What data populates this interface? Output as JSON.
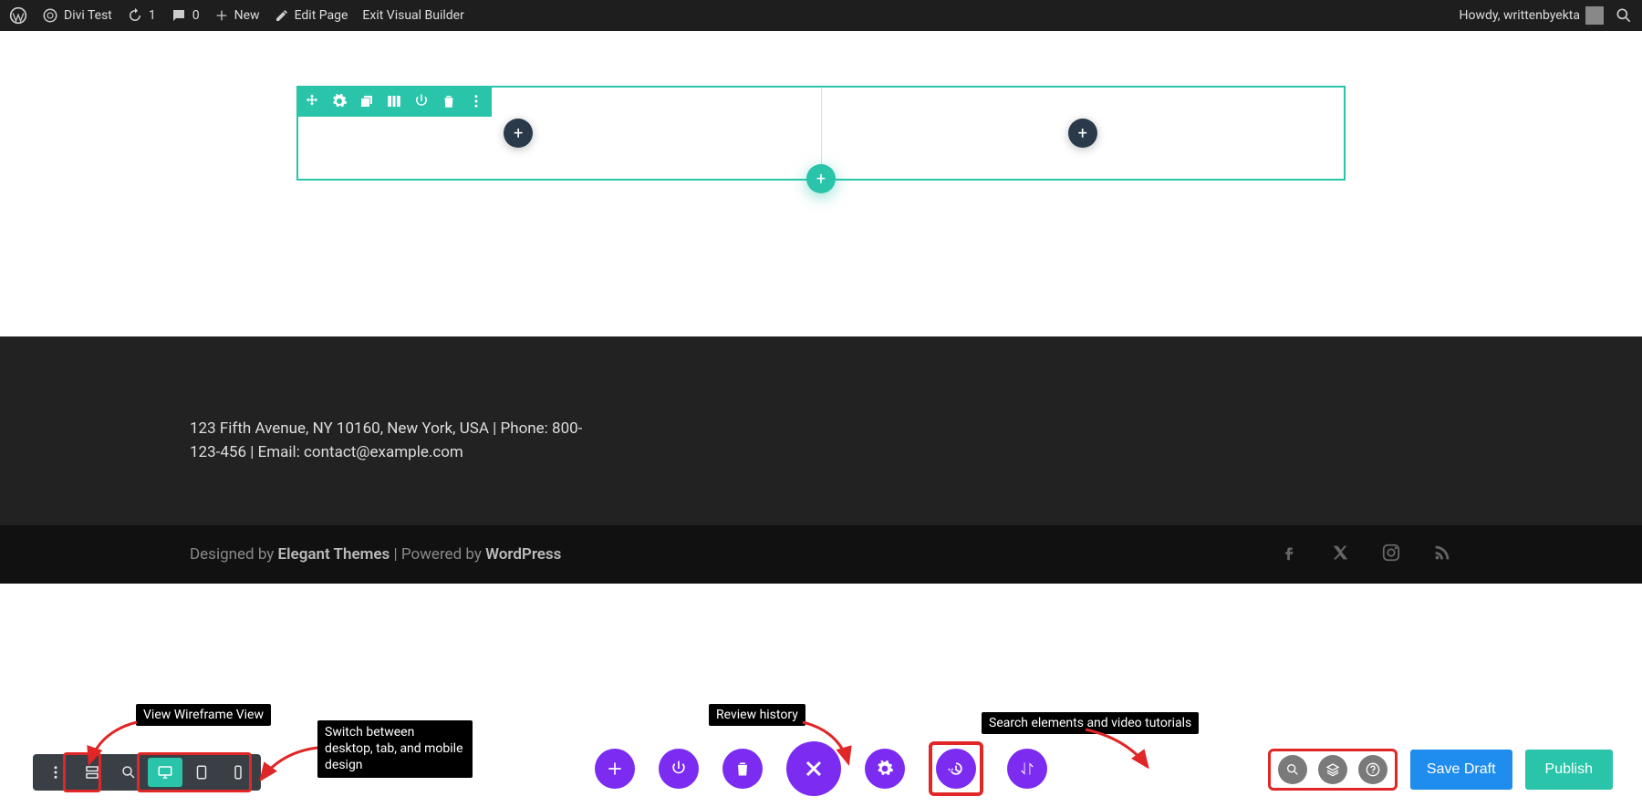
{
  "admin_bar": {
    "site_title": "Divi Test",
    "updates_count": "1",
    "comments_count": "0",
    "new_label": "New",
    "edit_page_label": "Edit Page",
    "exit_vb_label": "Exit Visual Builder",
    "howdy": "Howdy, writtenbyekta"
  },
  "footer": {
    "address_line": "123 Fifth Avenue, NY 10160, New York, USA | Phone: 800-123-456 | Email: contact@example.com",
    "designed_by_prefix": "Designed by ",
    "designed_by_brand": "Elegant Themes",
    "powered_by_prefix": " | Powered by ",
    "powered_by_brand": "WordPress"
  },
  "builder": {
    "save_draft": "Save Draft",
    "publish": "Publish"
  },
  "annotations": {
    "wireframe": "View Wireframe View",
    "devices": "Switch between desktop, tab, and mobile design",
    "history": "Review history",
    "search": "Search elements and video tutorials"
  }
}
